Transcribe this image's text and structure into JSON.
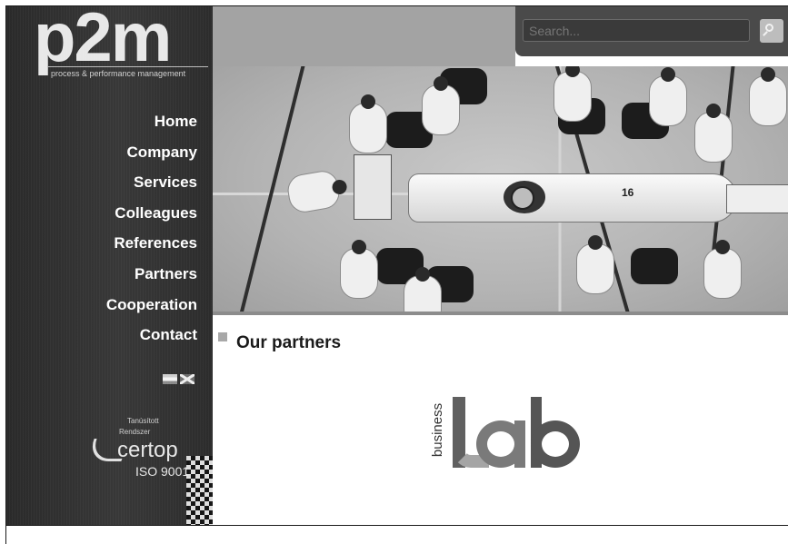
{
  "logo": {
    "wordmark": "p2m",
    "tagline": "process & performance management"
  },
  "search": {
    "placeholder": "Search..."
  },
  "nav": {
    "items": [
      {
        "label": "Home"
      },
      {
        "label": "Company"
      },
      {
        "label": "Services"
      },
      {
        "label": "Colleagues"
      },
      {
        "label": "References"
      },
      {
        "label": "Partners"
      },
      {
        "label": "Cooperation"
      },
      {
        "label": "Contact"
      }
    ]
  },
  "languages": [
    {
      "icon": "hungarian-flag-icon"
    },
    {
      "icon": "uk-flag-icon"
    }
  ],
  "certification": {
    "line1": "Tanúsított",
    "line2": "Rendszer",
    "name": "certop",
    "standard": "ISO 9001"
  },
  "hero": {
    "car_number": "16"
  },
  "content": {
    "title": "Our partners",
    "partner": {
      "vertical_text": "business",
      "wordmark": "lab"
    }
  },
  "colors": {
    "sidebar": "#333333",
    "header_gray": "#a3a3a3",
    "header_dark": "#4a4a4a",
    "nav_text": "#ffffff"
  }
}
